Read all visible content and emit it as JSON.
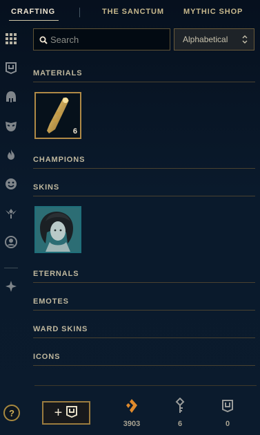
{
  "tabs": [
    {
      "label": "CRAFTING",
      "active": true
    },
    {
      "label": "THE SANCTUM",
      "active": false
    },
    {
      "label": "MYTHIC SHOP",
      "active": false
    }
  ],
  "sidebar": {
    "items": [
      {
        "icon": "grid-icon"
      },
      {
        "icon": "chest-icon"
      },
      {
        "icon": "helmet-icon"
      },
      {
        "icon": "mask-icon"
      },
      {
        "icon": "flame-icon"
      },
      {
        "icon": "emote-face-icon"
      },
      {
        "icon": "ward-icon"
      },
      {
        "icon": "profile-icon"
      },
      {
        "icon": "crest-icon"
      }
    ]
  },
  "search": {
    "placeholder": "Search",
    "value": ""
  },
  "sort": {
    "selected": "Alphabetical"
  },
  "sections": {
    "materials": "MATERIALS",
    "champions": "CHAMPIONS",
    "skins": "SKINS",
    "eternals": "ETERNALS",
    "emotes": "EMOTES",
    "ward_skins": "WARD SKINS",
    "icons": "ICONS"
  },
  "materials": [
    {
      "name": "hextech-key-fragment",
      "count": "6"
    }
  ],
  "skins": [
    {
      "name": "champion-skin-shard"
    }
  ],
  "footer": {
    "help_label": "?",
    "add_label": "+",
    "currencies": [
      {
        "icon": "blue-essence-icon",
        "value": "3903"
      },
      {
        "icon": "key-icon",
        "value": "6"
      },
      {
        "icon": "chest-icon",
        "value": "0"
      }
    ]
  },
  "colors": {
    "gold": "#c8aa6e",
    "accent_orange": "#e08a2c",
    "background": "#0a1a2c"
  }
}
